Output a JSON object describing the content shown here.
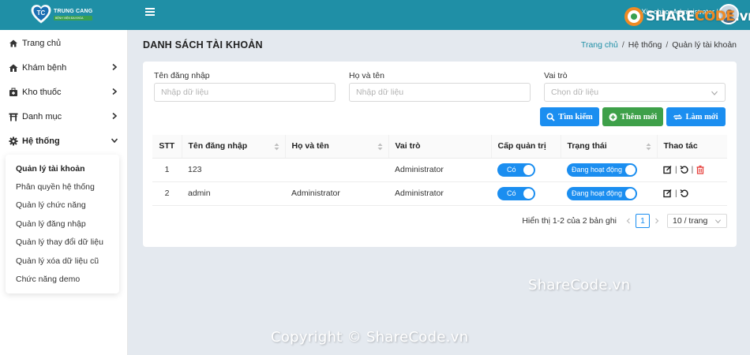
{
  "header": {
    "logo_name": "TRUNG CANG",
    "logo_tagline": "BỆNH VIỆN ĐA KHOA",
    "greeting": "Xin chào, Administrator !",
    "watermark_logo_part1": "SHARE",
    "watermark_logo_part2": "CODE",
    "watermark_logo_part3": ".vn",
    "accent_color": "#1f8fa6"
  },
  "sidebar": {
    "items": [
      {
        "label": "Trang chủ",
        "icon": "home-icon"
      },
      {
        "label": "Khám bệnh",
        "icon": "hospital-icon"
      },
      {
        "label": "Kho thuốc",
        "icon": "medkit-icon"
      },
      {
        "label": "Danh mục",
        "icon": "torii-icon"
      },
      {
        "label": "Hệ thống",
        "icon": "cog-icon"
      }
    ],
    "submenu": [
      "Quản lý tài khoản",
      "Phân quyền hệ thống",
      "Quản lý chức năng",
      "Quản lý đăng nhập",
      "Quản lý thay đổi dữ liệu",
      "Quản lý xóa dữ liệu cũ",
      "Chức năng demo"
    ]
  },
  "page": {
    "title": "DANH SÁCH TÀI KHOẢN",
    "breadcrumb": {
      "home": "Trang chủ",
      "sep": "/",
      "level1": "Hệ thống",
      "level2": "Quản lý tài khoản"
    }
  },
  "filters": {
    "username_label": "Tên đăng nhập",
    "username_placeholder": "Nhập dữ liệu",
    "fullname_label": "Họ và tên",
    "fullname_placeholder": "Nhập dữ liệu",
    "role_label": "Vai trò",
    "role_placeholder": "Chọn dữ liệu"
  },
  "buttons": {
    "search": "Tìm kiếm",
    "add": "Thêm mới",
    "refresh": "Làm mới"
  },
  "table": {
    "headers": [
      "STT",
      "Tên đăng nhập",
      "Họ và tên",
      "Vai trò",
      "Cấp quản trị",
      "Trạng thái",
      "Thao tác"
    ],
    "rows": [
      {
        "stt": "1",
        "username": "123",
        "fullname": "",
        "role": "Administrator",
        "admin": "Có",
        "status": "Đang hoạt động"
      },
      {
        "stt": "2",
        "username": "admin",
        "fullname": "Administrator",
        "role": "Administrator",
        "admin": "Có",
        "status": "Đang hoạt động"
      }
    ]
  },
  "pagination": {
    "info": "Hiển thị 1-2 của 2 bản ghi",
    "current_page": "1",
    "page_size": "10 / trang"
  },
  "watermarks": {
    "middle": "ShareCode.vn",
    "copyright": "Copyright © ShareCode.vn"
  }
}
